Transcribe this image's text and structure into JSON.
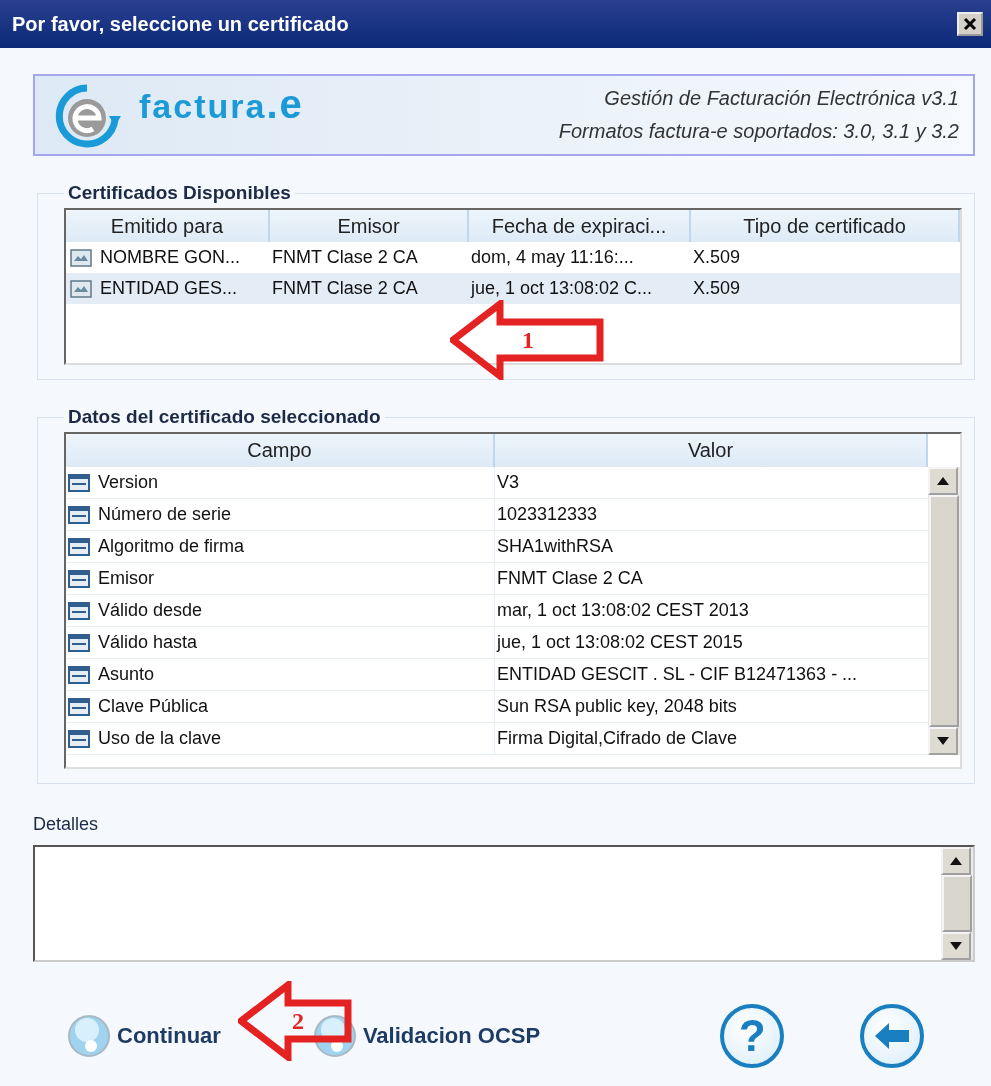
{
  "window": {
    "title": "Por favor, seleccione un certificado"
  },
  "banner": {
    "logo_text": "factura",
    "logo_suffix": ".e",
    "line_1": "Gestión de Facturación Electrónica v3.1",
    "line_2": "Formatos factura-e soportados: 3.0, 3.1 y 3.2"
  },
  "certificates": {
    "title": "Certificados Disponibles",
    "columns": [
      "Emitido para",
      "Emisor",
      "Fecha de expiraci...",
      "Tipo de certificado"
    ],
    "rows": [
      {
        "selected": false,
        "cells": [
          "NOMBRE GON...",
          "FNMT Clase 2 CA",
          "dom, 4 may 11:16:...",
          "X.509"
        ]
      },
      {
        "selected": true,
        "cells": [
          "ENTIDAD GES...",
          "FNMT Clase 2 CA",
          "jue, 1 oct 13:08:02 C...",
          "X.509"
        ]
      }
    ]
  },
  "details_table": {
    "title": "Datos del certificado seleccionado",
    "columns": [
      "Campo",
      "Valor"
    ],
    "rows": [
      {
        "field": "Version",
        "value": "V3"
      },
      {
        "field": "Número de serie",
        "value": "1023312333"
      },
      {
        "field": "Algoritmo de firma",
        "value": "SHA1withRSA"
      },
      {
        "field": "Emisor",
        "value": "FNMT Clase 2 CA"
      },
      {
        "field": "Válido desde",
        "value": "mar, 1 oct 13:08:02 CEST 2013"
      },
      {
        "field": "Válido hasta",
        "value": "jue, 1 oct 13:08:02 CEST 2015"
      },
      {
        "field": "Asunto",
        "value": "ENTIDAD GESCIT . SL - CIF B12471363 - ..."
      },
      {
        "field": "Clave Pública",
        "value": "Sun RSA public key, 2048 bits"
      },
      {
        "field": "Uso de la clave",
        "value": "Firma Digital,Cifrado de Clave"
      }
    ]
  },
  "details": {
    "label": "Detalles"
  },
  "buttons": [
    {
      "kind": "bubble",
      "label": "Continuar"
    },
    {
      "kind": "bubble",
      "label": "Validacion OCSP"
    },
    {
      "kind": "help",
      "label": "?"
    },
    {
      "kind": "back"
    }
  ],
  "annotations": [
    {
      "number": "1"
    },
    {
      "number": "2"
    }
  ]
}
